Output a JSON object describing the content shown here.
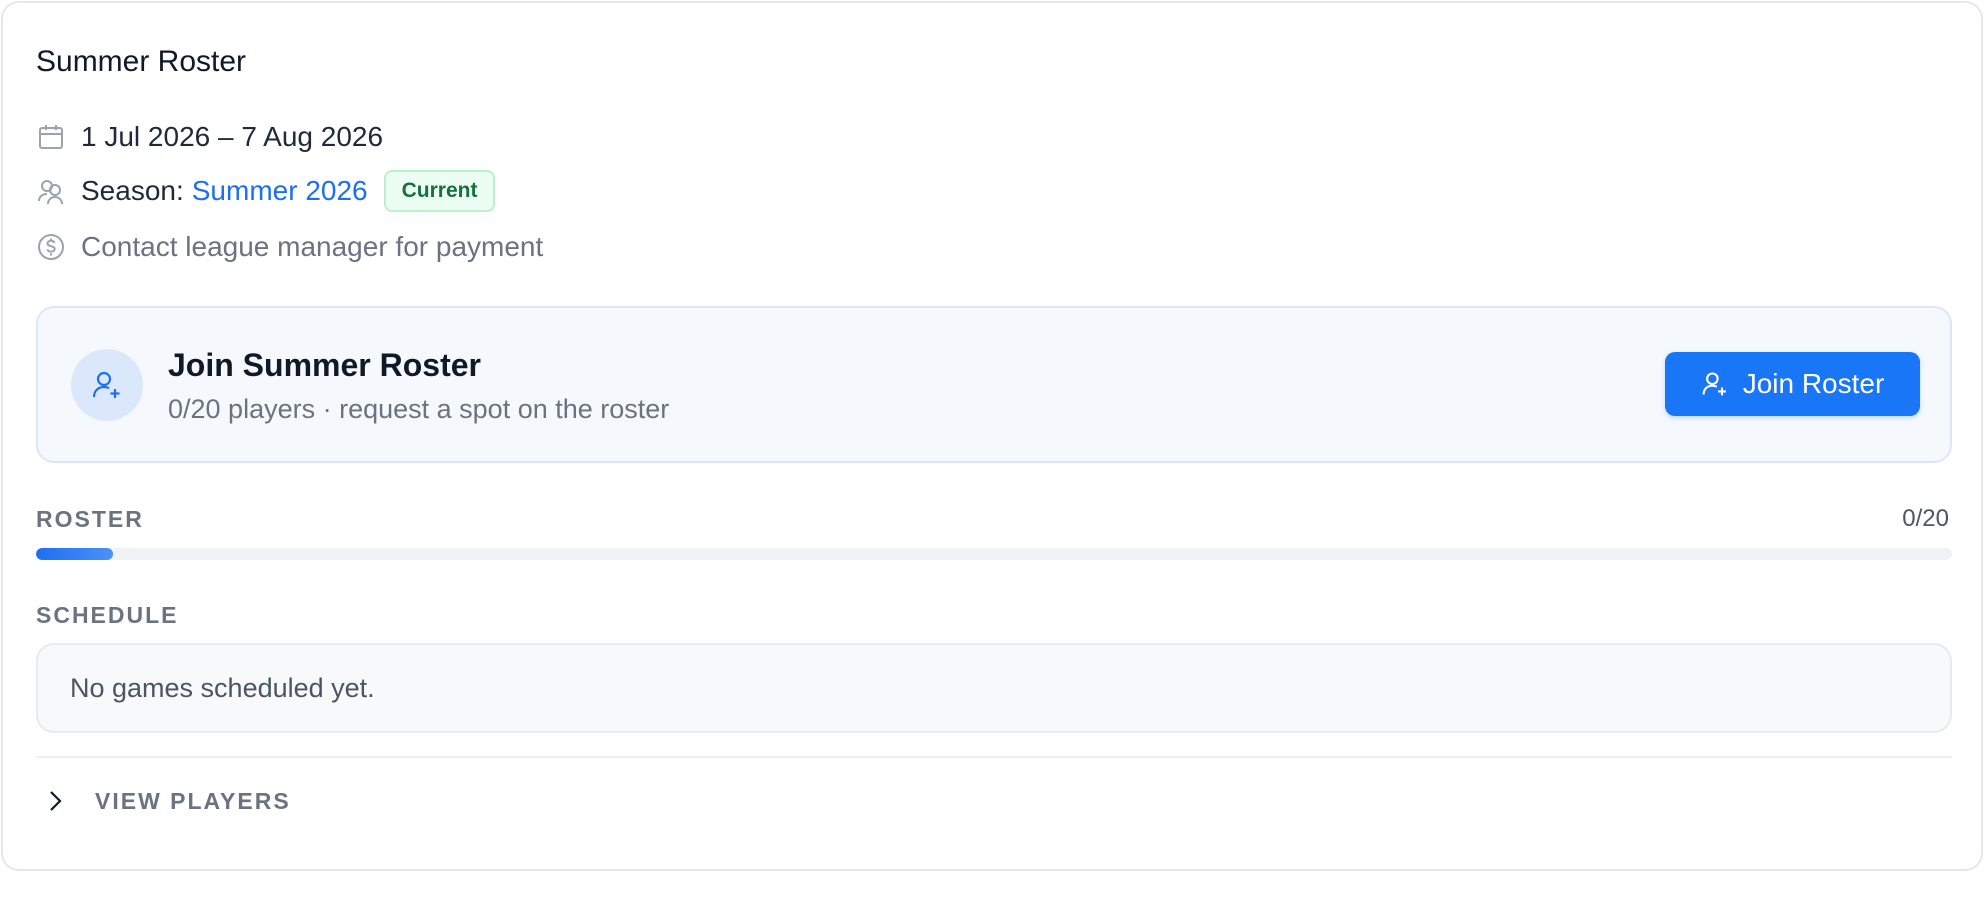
{
  "card": {
    "title": "Summer Roster",
    "date_range": "1 Jul 2026 – 7 Aug 2026",
    "season_label": "Season:",
    "season_name": "Summer 2026",
    "season_badge": "Current",
    "payment_note": "Contact league manager for payment"
  },
  "join": {
    "title": "Join Summer Roster",
    "subtitle": "0/20 players · request a spot on the roster",
    "button_label": "Join Roster"
  },
  "roster": {
    "label": "ROSTER",
    "count": "0/20",
    "progress_fraction": 0.04
  },
  "schedule": {
    "label": "SCHEDULE",
    "empty_text": "No games scheduled yet."
  },
  "players": {
    "toggle_label": "VIEW PLAYERS"
  },
  "colors": {
    "accent": "#1976f7",
    "link": "#1d6ff2",
    "badge_bg": "#ecfdf3",
    "badge_text": "#16703f",
    "muted": "#6b7280"
  },
  "icons": {
    "date": "calendar-icon",
    "season": "users-icon",
    "payment": "dollar-circle-icon",
    "join": "user-plus-icon",
    "expand": "chevron-right-icon"
  }
}
